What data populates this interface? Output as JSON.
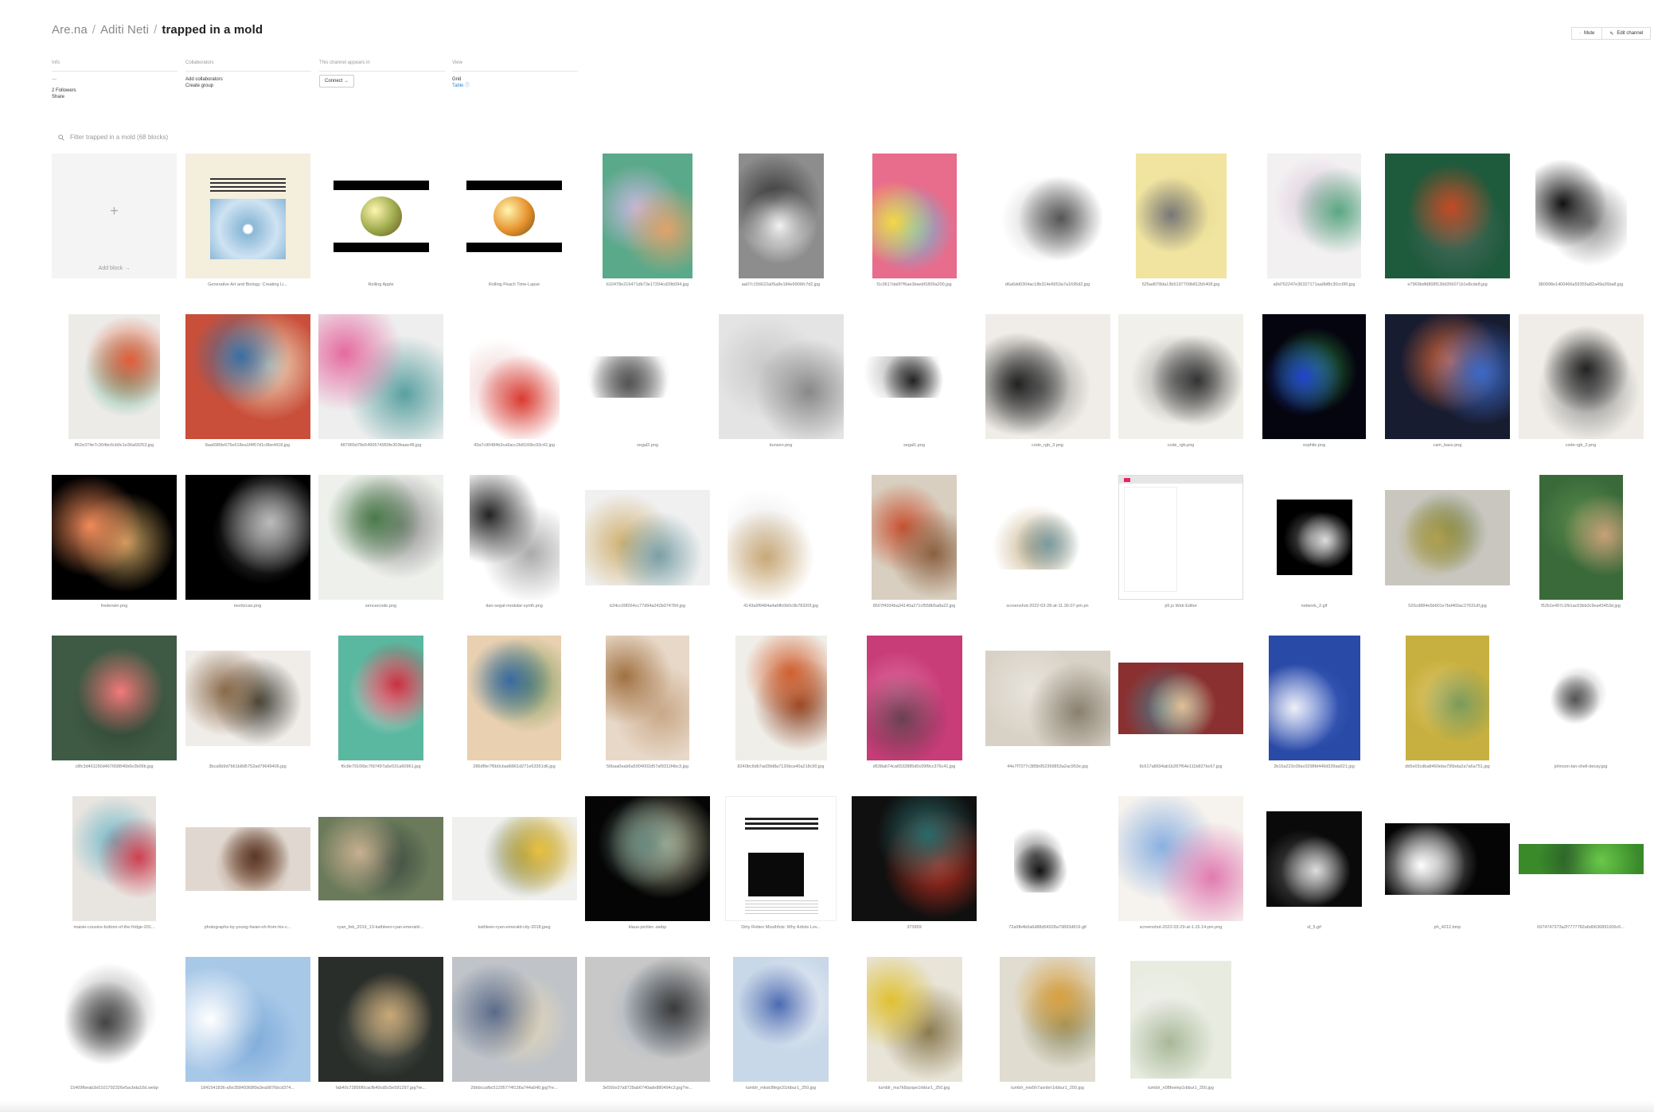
{
  "breadcrumb": {
    "site": "Are.na",
    "user": "Aditi Neti",
    "channel": "trapped in a mold",
    "separator": "/"
  },
  "actions": {
    "mute": "Mute",
    "edit": "Edit channel"
  },
  "meta": {
    "info": {
      "heading": "Info",
      "description": "—",
      "followers": "2 Followers",
      "share": "Share"
    },
    "collaborators": {
      "heading": "Collaborators",
      "add": "Add collaborators",
      "create_group": "Create group"
    },
    "appears": {
      "heading": "This channel appears in",
      "connect": "Connect →"
    },
    "view": {
      "heading": "View",
      "grid": "Grid",
      "table": "Table ⓘ"
    }
  },
  "filter": {
    "placeholder": "Filter trapped in a mold (68 blocks)"
  },
  "add_block": {
    "plus": "+",
    "label": "Add block →"
  },
  "blocks": [
    {
      "caption": "Generative Art and Biology: Creating Li...",
      "kind": "doc",
      "colors": [
        "#f4eedc",
        "#8bb8d8"
      ],
      "w": 157,
      "h": 157
    },
    {
      "caption": "Rolling Apple",
      "kind": "apple",
      "colors": [
        "#ffffff",
        "#9aa84a"
      ],
      "w": 120,
      "h": 90
    },
    {
      "caption": "Rolling Peach Time-Lapse",
      "kind": "apple",
      "colors": [
        "#ffffff",
        "#e6912b"
      ],
      "w": 120,
      "h": 90
    },
    {
      "caption": "b10478e216471db73e17294cd29b094.jpg",
      "kind": "img",
      "colors": [
        "#5aa98a",
        "#e0a26a",
        "#c8b8e0"
      ],
      "w": 113,
      "h": 157
    },
    {
      "caption": "aa07c156622a05a8e184e9906fc7d2.jpg",
      "kind": "img",
      "colors": [
        "#8d8d8d",
        "#f2f2f2",
        "#333333"
      ],
      "w": 107,
      "h": 157
    },
    {
      "caption": "f1c0617da0f7f6ae3baebf1809a200.jpg",
      "kind": "img",
      "colors": [
        "#e86c8c",
        "#f5d547",
        "#5dc1e0"
      ],
      "w": 106,
      "h": 157
    },
    {
      "caption": "d6a6dd0304ac18b314e6653a7a1695d2.jpg",
      "kind": "img",
      "colors": [
        "#ffffff",
        "#555555",
        "#cccccc"
      ],
      "w": 140,
      "h": 157
    },
    {
      "caption": "525ad078da13b5197709b812b5408.jpg",
      "kind": "img",
      "colors": [
        "#f0e4a0",
        "#777777",
        "#e8d890"
      ],
      "w": 114,
      "h": 157
    },
    {
      "caption": "a9d762247e36327171aa9bf8c30cc6f0.jpg",
      "kind": "img",
      "colors": [
        "#f3f0f2",
        "#5aa882",
        "#d9c8d8"
      ],
      "w": 118,
      "h": 157
    },
    {
      "caption": "e7969bdfd808f139d356071b1e8cde8.jpg",
      "kind": "img",
      "colors": [
        "#1e5a3c",
        "#c34a24",
        "#4a6a5c"
      ],
      "w": 157,
      "h": 157
    },
    {
      "caption": "380998e1400466a59355a82a49a26ba8.jpg",
      "kind": "img",
      "colors": [
        "#ffffff",
        "#111111",
        "#888888"
      ],
      "w": 115,
      "h": 157
    },
    {
      "caption": "ff62e374e7c304bc6cb0c1e36a69253.jpg",
      "kind": "img",
      "colors": [
        "#ecebe8",
        "#e35c3a",
        "#5db090"
      ],
      "w": 115,
      "h": 157
    },
    {
      "caption": "8aa6989e675e618ea1f4f57d1c9be4418.jpg",
      "kind": "img",
      "colors": [
        "#c94f3a",
        "#3a6ea0",
        "#efe2c5"
      ],
      "w": 157,
      "h": 157
    },
    {
      "caption": "487965d78e5490574950fe303baac48.jpg",
      "kind": "img",
      "colors": [
        "#eeeeee",
        "#e56aa0",
        "#5aa0a0"
      ],
      "w": 157,
      "h": 157
    },
    {
      "caption": "43a7c90484b3ca9acc2b8160bc93c42.jpg",
      "kind": "img",
      "colors": [
        "#ffffff",
        "#d93a30",
        "#f0d0d0"
      ],
      "w": 113,
      "h": 157
    },
    {
      "caption": "segal2.png",
      "kind": "img",
      "colors": [
        "#ffffff",
        "#555555",
        "#999999"
      ],
      "w": 157,
      "h": 52
    },
    {
      "caption": "bunsen.png",
      "kind": "img",
      "colors": [
        "#e4e4e4",
        "#888888",
        "#c8c8c8"
      ],
      "w": 157,
      "h": 157
    },
    {
      "caption": "segal1.png",
      "kind": "img",
      "colors": [
        "#ffffff",
        "#222222",
        "#aaaaaa"
      ],
      "w": 157,
      "h": 52
    },
    {
      "caption": "code_rgb_3.png",
      "kind": "img",
      "colors": [
        "#f0ede8",
        "#222222",
        "#8a8a8a"
      ],
      "w": 157,
      "h": 157
    },
    {
      "caption": "code_rgb.png",
      "kind": "img",
      "colors": [
        "#f2f0ea",
        "#333333",
        "#999999"
      ],
      "w": 157,
      "h": 157
    },
    {
      "caption": "sophile.png",
      "kind": "img",
      "colors": [
        "#050510",
        "#2244cc",
        "#2a8a3a"
      ],
      "w": 130,
      "h": 157
    },
    {
      "caption": "cam_bass.png",
      "kind": "img",
      "colors": [
        "#181c30",
        "#3a6ac8",
        "#e06a3a"
      ],
      "w": 157,
      "h": 157
    },
    {
      "caption": "code-rgb_2.png",
      "kind": "img",
      "colors": [
        "#f0ede8",
        "#222222",
        "#888888"
      ],
      "w": 157,
      "h": 157
    },
    {
      "caption": "frederwin.png",
      "kind": "img",
      "colors": [
        "#000000",
        "#f08a5a",
        "#c8a060"
      ],
      "w": 157,
      "h": 157
    },
    {
      "caption": "moritzcao.png",
      "kind": "img",
      "colors": [
        "#000000",
        "#bbbbbb",
        "#555555"
      ],
      "w": 157,
      "h": 157
    },
    {
      "caption": "sencarcode.png",
      "kind": "img",
      "colors": [
        "#eef0ec",
        "#4a7a4a",
        "#888888"
      ],
      "w": 157,
      "h": 157
    },
    {
      "caption": "dan-segal-modular-synth.png",
      "kind": "img",
      "colors": [
        "#ffffff",
        "#222222",
        "#aaaaaa"
      ],
      "w": 113,
      "h": 157
    },
    {
      "caption": "b34cc09f264cc77d94a242b074784.jpg",
      "kind": "img",
      "colors": [
        "#f0f0f0",
        "#7aa0a8",
        "#d0b070"
      ],
      "w": 157,
      "h": 120
    },
    {
      "caption": "4143a9f9484a4a6ffc0b0c9b78320f.jpg",
      "kind": "img",
      "colors": [
        "#ffffff",
        "#c8a878",
        "#eaeaea"
      ],
      "w": 135,
      "h": 157
    },
    {
      "caption": "8507f4934ba34140a271cf558b5a8a22.jpg",
      "kind": "img",
      "colors": [
        "#d9cfc0",
        "#8a6040",
        "#c85030"
      ],
      "w": 107,
      "h": 157
    },
    {
      "caption": "screenshot-2022-03-28-at-11.30.07-pm.pn",
      "kind": "img",
      "colors": [
        "#ffffff",
        "#7a9aa0",
        "#c8b088"
      ],
      "w": 157,
      "h": 80
    },
    {
      "caption": "p5.js Web Editor",
      "kind": "screen",
      "colors": [
        "#ffffff",
        "#ed225d",
        "#e6e6e6"
      ],
      "w": 157,
      "h": 157
    },
    {
      "caption": "network_2.gif",
      "kind": "img",
      "colors": [
        "#000000",
        "#dddddd",
        "#666666"
      ],
      "w": 95,
      "h": 95
    },
    {
      "caption": "520cd884e5b601e7bd465ac27631df.jpg",
      "kind": "img",
      "colors": [
        "#c8c6bf",
        "#b0a050",
        "#6a7a40"
      ],
      "w": 157,
      "h": 120
    },
    {
      "caption": "f52b1e497c1fb1ac53bb3c9ea43453d.jpg",
      "kind": "img",
      "colors": [
        "#3a6a3a",
        "#c8a078",
        "#5a8a4a"
      ],
      "w": 105,
      "h": 157
    },
    {
      "caption": "c8fc3d461150d467658846b6e2b09b.jpg",
      "kind": "img",
      "colors": [
        "#3f5a44",
        "#f27a7a",
        "#2c4434"
      ],
      "w": 157,
      "h": 157
    },
    {
      "caption": "3bca9b9d7b61b8d5752ad79649406.jpg",
      "kind": "img",
      "colors": [
        "#f0ece8",
        "#8a6a4a",
        "#3a3a30"
      ],
      "w": 157,
      "h": 120
    },
    {
      "caption": "f6c8e79106bc7fd7497a5e531a60961.jpg",
      "kind": "img",
      "colors": [
        "#5ab8a0",
        "#c83040",
        "#f0d0d8"
      ],
      "w": 107,
      "h": 157
    },
    {
      "caption": "286df9e7f6b0cbad6861d271e63351d6.jpg",
      "kind": "img",
      "colors": [
        "#e8d0b0",
        "#3a6aa0",
        "#7a9a5a"
      ],
      "w": 118,
      "h": 157
    },
    {
      "caption": "56baa0eab6a5904002d57af9311f4bc3.jpg",
      "kind": "img",
      "colors": [
        "#e8d8c8",
        "#a07040",
        "#c8a888"
      ],
      "w": 105,
      "h": 157
    },
    {
      "caption": "8240bc6db7ad39d8a7120bca40a218c90.jpg",
      "kind": "img",
      "colors": [
        "#f0eee8",
        "#d06030",
        "#8a4020"
      ],
      "w": 115,
      "h": 157
    },
    {
      "caption": "d538ab74ca6532885d0c09f9cc376c41.jpg",
      "kind": "img",
      "colors": [
        "#c83c78",
        "#6a4050",
        "#e070a0"
      ],
      "w": 120,
      "h": 157
    },
    {
      "caption": "44e7f7377c385b952369853a2ac953e.jpg",
      "kind": "img",
      "colors": [
        "#d8d2c6",
        "#8a8070",
        "#e8e4dc"
      ],
      "w": 157,
      "h": 120
    },
    {
      "caption": "8c617a8694ab1b287f64e111b827bc67.jpg",
      "kind": "img",
      "colors": [
        "#8a3030",
        "#e0c098",
        "#4a7a8a"
      ],
      "w": 157,
      "h": 90
    },
    {
      "caption": "2b15a223c09ac0298fd449d339aa521.jpg",
      "kind": "img",
      "colors": [
        "#2a4aa8",
        "#eef0f8",
        "#4a6ac8"
      ],
      "w": 115,
      "h": 157
    },
    {
      "caption": "db5e03cdba8460eba795bda2a7a6a751.jpg",
      "kind": "img",
      "colors": [
        "#c8b040",
        "#7a9a5a",
        "#e0c870"
      ],
      "w": 105,
      "h": 157
    },
    {
      "caption": "johnson-tan-shell-decay.jpg",
      "kind": "img",
      "colors": [
        "#ffffff",
        "#555555",
        "#aaaaaa"
      ],
      "w": 95,
      "h": 85
    },
    {
      "caption": "maisie-cousins-bottom-of-the-fridge-201...",
      "kind": "img",
      "colors": [
        "#e8e4e0",
        "#d04050",
        "#70b8c8"
      ],
      "w": 105,
      "h": 157
    },
    {
      "caption": "photographs-by-young-hwan-oh-from-his-c...",
      "kind": "img",
      "colors": [
        "#e0d8d0",
        "#5a3828",
        "#a07860"
      ],
      "w": 157,
      "h": 80
    },
    {
      "caption": "ryan_feb_2019_13-kathleen-ryan-emerald-...",
      "kind": "img",
      "colors": [
        "#6a7a5a",
        "#c8b090",
        "#3a4a40"
      ],
      "w": 157,
      "h": 105
    },
    {
      "caption": "kathleen-ryan-emerald-city-2018.jpeg",
      "kind": "img",
      "colors": [
        "#f0f0ee",
        "#e8c040",
        "#6a7a50"
      ],
      "w": 157,
      "h": 105
    },
    {
      "caption": "klaus-pichler-.webp",
      "kind": "img",
      "colors": [
        "#050505",
        "#6a8a80",
        "#c8c8a8"
      ],
      "w": 157,
      "h": 157
    },
    {
      "caption": "Dirty Rotten Mouthfuls: Why Artists Lov...",
      "kind": "article",
      "colors": [
        "#ffffff",
        "#222222",
        "#cccccc"
      ],
      "w": 140,
      "h": 157
    },
    {
      "caption": "373959",
      "kind": "img",
      "colors": [
        "#101010",
        "#2a6a6a",
        "#c83020"
      ],
      "w": 157,
      "h": 157
    },
    {
      "caption": "72a9fb4b0a6d88d54928a79893d819.gif",
      "kind": "img",
      "colors": [
        "#ffffff",
        "#111111",
        "#777777"
      ],
      "w": 85,
      "h": 85
    },
    {
      "caption": "screenshot-2022-03-29-at-1.15.14-pm.png",
      "kind": "img",
      "colors": [
        "#f6f2ee",
        "#e07ab0",
        "#8ab0e0"
      ],
      "w": 157,
      "h": 157
    },
    {
      "caption": "sf_5.gif",
      "kind": "img",
      "colors": [
        "#0a0a0a",
        "#dddddd",
        "#555555"
      ],
      "w": 120,
      "h": 120
    },
    {
      "caption": "ph_4212.bmp",
      "kind": "img",
      "colors": [
        "#050505",
        "#ffffff",
        "#888888"
      ],
      "w": 157,
      "h": 90
    },
    {
      "caption": "6974747373a2f7777782a6d0636891006c6...",
      "kind": "img",
      "colors": [
        "#3a8a2a",
        "#6ac84a",
        "#2a5a2a"
      ],
      "w": 157,
      "h": 38
    },
    {
      "caption": "15409fbeab3e5101792326e5acbda10d.webp",
      "kind": "img",
      "colors": [
        "#ffffff",
        "#444444",
        "#999999"
      ],
      "w": 157,
      "h": 145
    },
    {
      "caption": "1841541836-a6e35849368f9a3ea9876bcd374...",
      "kind": "img",
      "colors": [
        "#a8c8e8",
        "#ffffff",
        "#7aa8d8"
      ],
      "w": 157,
      "h": 157
    },
    {
      "caption": "fab40c72856f0cacfb40cd5c5e591297.jpg?re...",
      "kind": "img",
      "colors": [
        "#2a2e2a",
        "#c8a878",
        "#6a6e60"
      ],
      "w": 157,
      "h": 157
    },
    {
      "caption": "2bbbccafbc51295774f136a744a040.jpg?re...",
      "kind": "img",
      "colors": [
        "#c0c4c8",
        "#5a6a8a",
        "#e8d8b8"
      ],
      "w": 157,
      "h": 157
    },
    {
      "caption": "3e556e37a8728ab6740ade880494c3.jpg?re...",
      "kind": "img",
      "colors": [
        "#c8c8c8",
        "#3a3a3a",
        "#a0b0c0"
      ],
      "w": 157,
      "h": 157
    },
    {
      "caption": "tumblr_mkdc8fegx31rbbur1_250.jpg",
      "kind": "img",
      "colors": [
        "#c8d8e8",
        "#4a6ab0",
        "#f0f0f8"
      ],
      "w": 120,
      "h": 157
    },
    {
      "caption": "tumblr_ma7k8zpspe1rbbur1_250.jpg",
      "kind": "img",
      "colors": [
        "#e8e4d8",
        "#e0c030",
        "#8a7a50"
      ],
      "w": 120,
      "h": 157
    },
    {
      "caption": "tumblr_mw5h7axnbrr1rbbur1_250.jpg",
      "kind": "img",
      "colors": [
        "#e0dcd0",
        "#d8a040",
        "#8a8a60"
      ],
      "w": 120,
      "h": 157
    },
    {
      "caption": "tumblr_n08foelep1rbbur1_250.jpg",
      "kind": "img",
      "colors": [
        "#e8ece0",
        "#a8b898",
        "#f0f0ec"
      ],
      "w": 127,
      "h": 148
    }
  ]
}
